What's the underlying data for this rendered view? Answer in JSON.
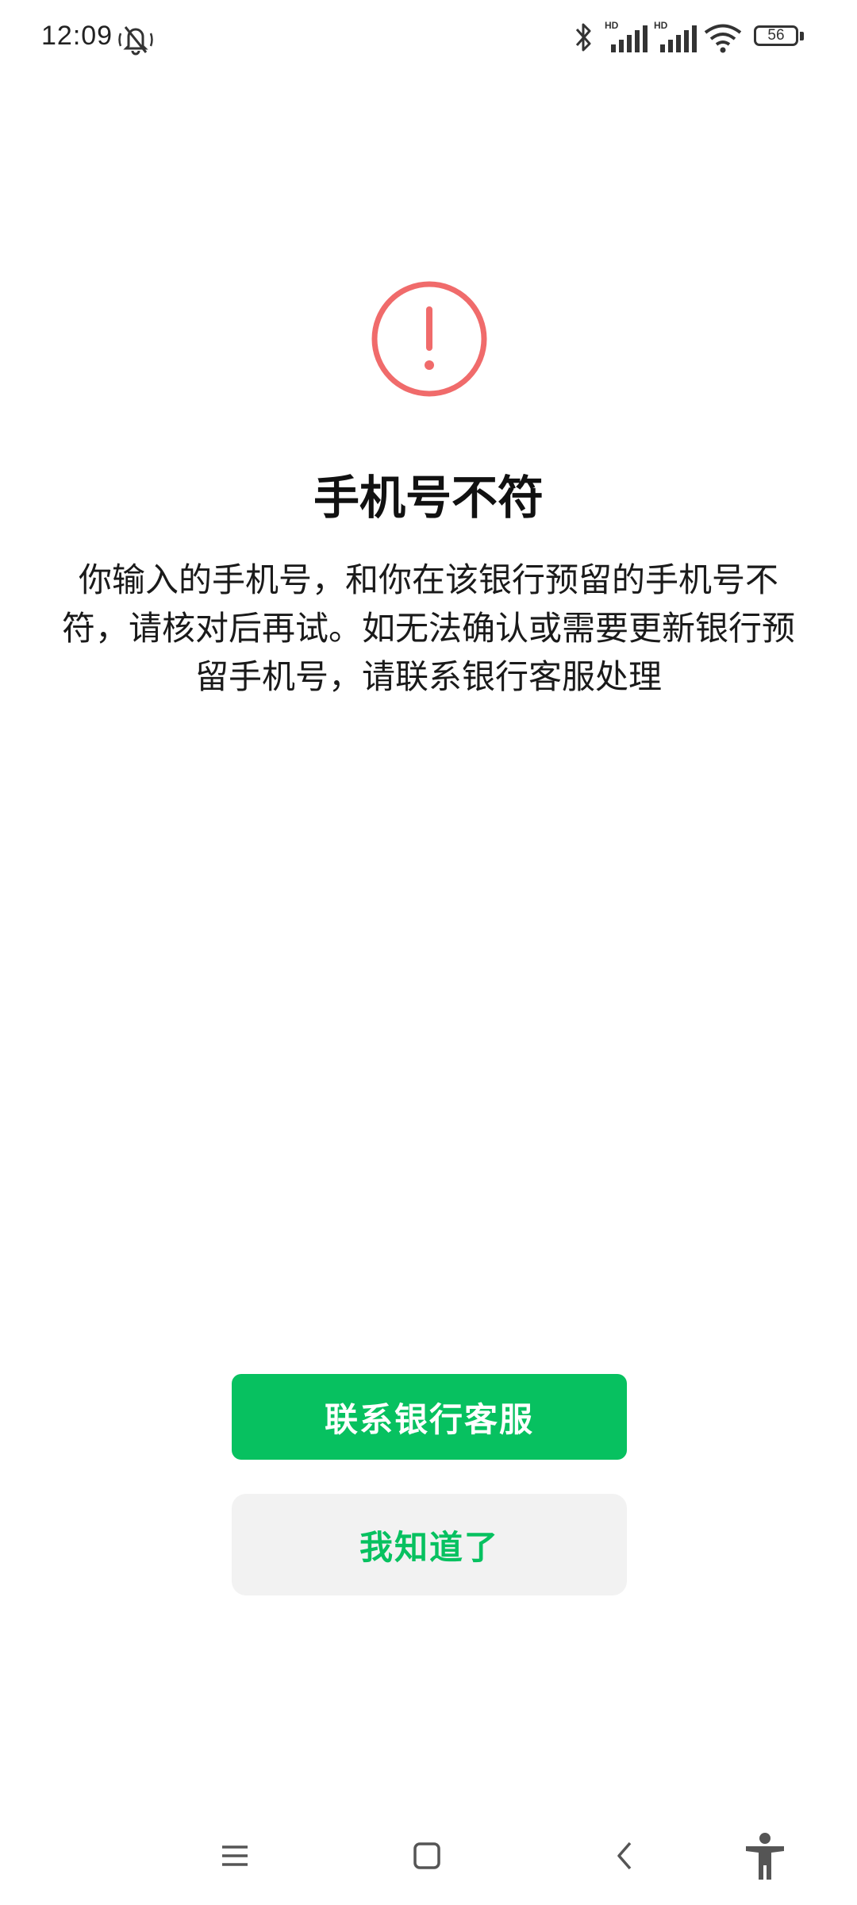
{
  "status_bar": {
    "time": "12:09",
    "battery": "56",
    "icons": [
      "mute-icon",
      "bluetooth-icon",
      "signal-hd-icon",
      "signal-hd-icon",
      "wifi-icon",
      "battery-icon"
    ]
  },
  "dialog": {
    "icon": "alert-icon",
    "accent_color": "#f06b6b",
    "title": "手机号不符",
    "description": "你输入的手机号，和你在该银行预留的手机号不符，请核对后再试。如无法确认或需要更新银行预留手机号，请联系银行客服处理",
    "primary_button": "联系银行客服",
    "secondary_button": "我知道了",
    "primary_color": "#07c160",
    "secondary_bg": "#f2f2f2"
  },
  "nav_bar": {
    "icons": [
      "menu-icon",
      "home-icon",
      "back-icon",
      "accessibility-icon"
    ]
  }
}
